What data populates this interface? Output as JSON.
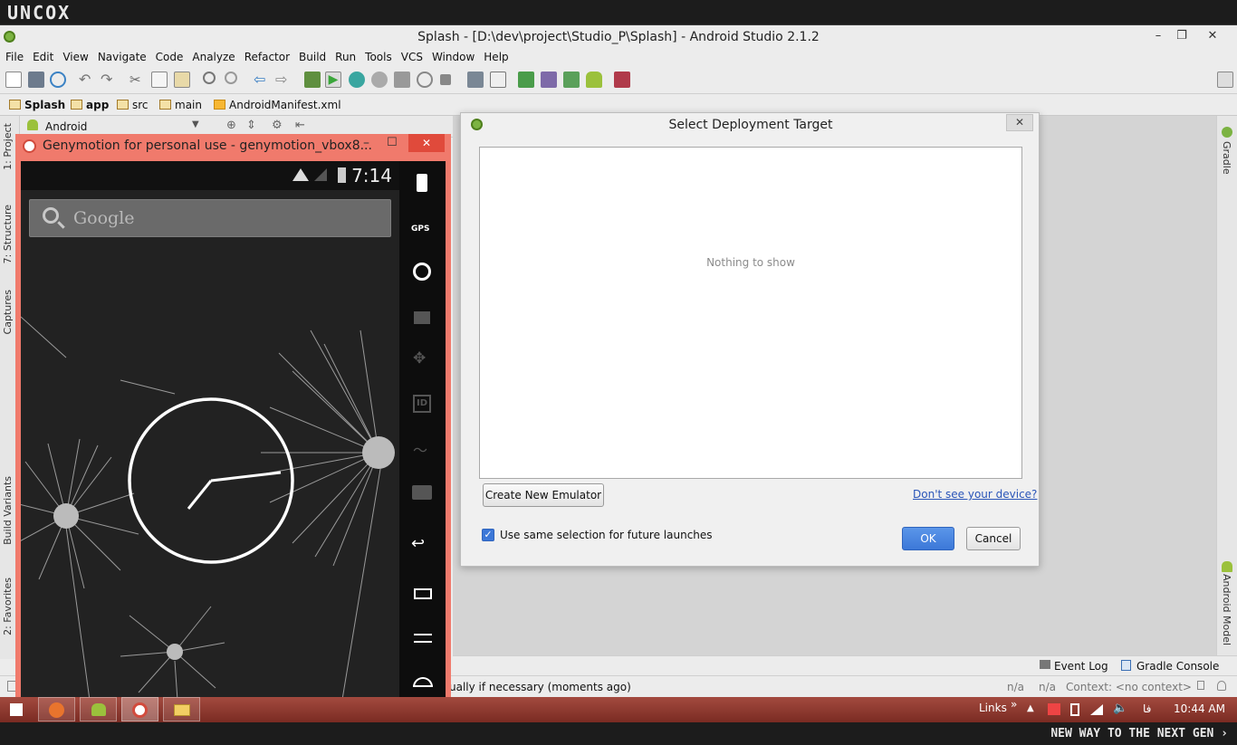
{
  "brand": {
    "logo_text": "UNCOX",
    "tagline": "NEW WAY TO THE NEXT GEN ›"
  },
  "window": {
    "title": "Splash - [D:\\dev\\project\\Studio_P\\Splash] - Android Studio 2.1.2",
    "minimize": "–",
    "restore": "❐",
    "close": "✕"
  },
  "menu": [
    "File",
    "Edit",
    "View",
    "Navigate",
    "Code",
    "Analyze",
    "Refactor",
    "Build",
    "Run",
    "Tools",
    "VCS",
    "Window",
    "Help"
  ],
  "breadcrumbs": [
    "Splash",
    "app",
    "src",
    "main",
    "AndroidManifest.xml"
  ],
  "project_panel": {
    "view_selector": "Android"
  },
  "left_tabs": [
    "1: Project",
    "7: Structure",
    "Captures",
    "Build Variants",
    "2: Favorites"
  ],
  "right_tabs": [
    "Gradle",
    "Android Model"
  ],
  "bottom_tools": {
    "event_log": "Event Log",
    "gradle_console": "Gradle Console"
  },
  "status": {
    "message": "ually if necessary (moments ago)",
    "n_a_1": "n/a",
    "n_a_2": "n/a",
    "context": "Context: <no context>"
  },
  "dialog": {
    "title": "Select Deployment Target",
    "empty_text": "Nothing to show",
    "create_emulator": "Create New Emulator",
    "dont_see_device": "Don't see your device?",
    "checkbox_label": "Use same selection for future launches",
    "checkbox_checked": true,
    "ok": "OK",
    "cancel": "Cancel",
    "close": "✕"
  },
  "genymotion": {
    "title": "Genymotion for personal use - genymotion_vbox8...",
    "minimize": "–",
    "maximize": "☐",
    "close": "✕",
    "clock": "7:14",
    "search_placeholder": "Google",
    "gps_label": "GPS",
    "id_label": "ID"
  },
  "taskbar": {
    "links": "Links",
    "links_chevron": "»",
    "lang": "فا",
    "time": "10:44 AM"
  },
  "colors": {
    "accent": "#3c78d8",
    "run_green": "#3aa63a",
    "geny_frame": "#f07a6c",
    "android_green": "#9bc13c"
  }
}
